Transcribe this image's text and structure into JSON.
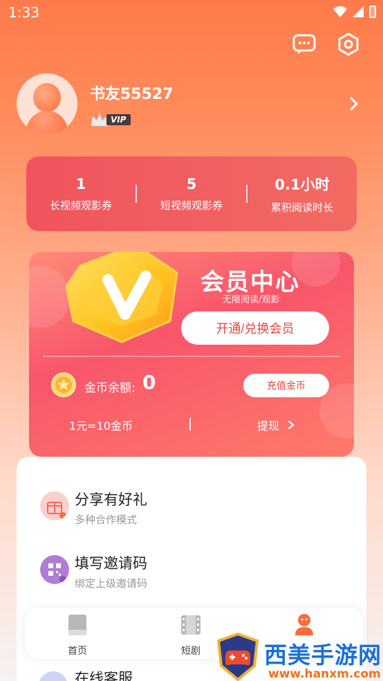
{
  "status_bar": {
    "time": "1:33"
  },
  "profile": {
    "username": "书友55527",
    "vip_label": "VIP"
  },
  "stats": [
    {
      "value": "1",
      "label": "长视频观影券"
    },
    {
      "value": "5",
      "label": "短视频观影券"
    },
    {
      "value": "0.1小时",
      "label": "累积阅读时长"
    }
  ],
  "vip_card": {
    "title": "会员中心",
    "subtitle": "无限阅读/观影",
    "open_button": "开通/兑换会员",
    "coin_label": "金币余额:",
    "coin_value": "0",
    "recharge_button": "充值金币",
    "rate": "1元=10金币",
    "withdraw": "提现"
  },
  "menu": [
    {
      "title": "分享有好礼",
      "subtitle": "多种合作模式",
      "icon": "gift-icon"
    },
    {
      "title": "填写邀请码",
      "subtitle": "绑定上级邀请码",
      "icon": "qr-icon"
    }
  ],
  "partial_menu_item": {
    "title": "在线客服"
  },
  "bottom_nav": [
    {
      "label": "首页",
      "icon": "book-icon"
    },
    {
      "label": "短剧",
      "icon": "film-icon"
    },
    {
      "label": "",
      "icon": "user-icon"
    }
  ],
  "watermark": {
    "title": "西美手游网",
    "url": "www.hanxm.com"
  },
  "colors": {
    "accent": "#f0535e",
    "button_text": "#e8443f",
    "watermark_blue": "#1b6fd6",
    "watermark_orange": "#f0701e"
  }
}
